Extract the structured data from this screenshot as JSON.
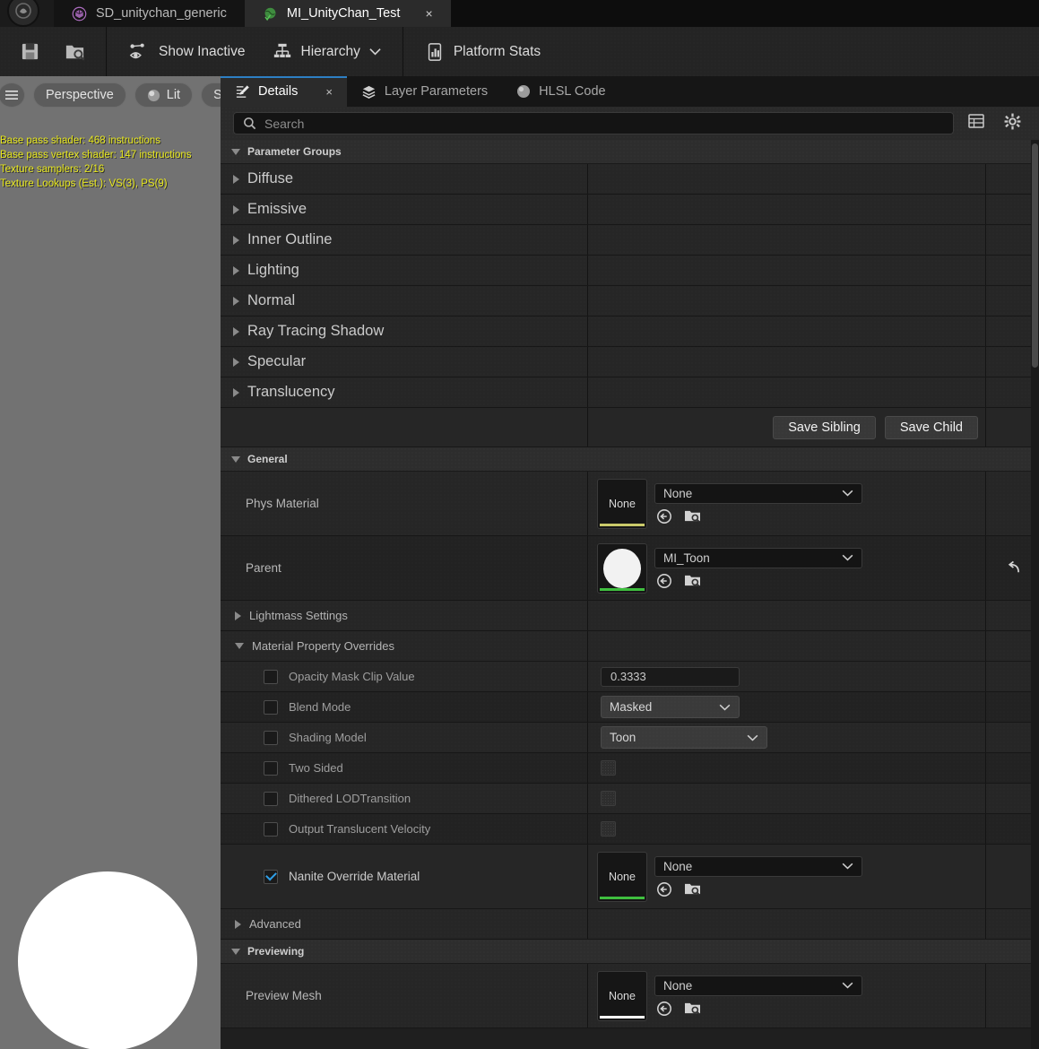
{
  "window": {
    "tabs": [
      {
        "label": "SD_unitychan_generic",
        "icon": "cube-purple-icon",
        "active": false,
        "closable": false
      },
      {
        "label": "MI_UnityChan_Test",
        "icon": "material-instance-green-icon",
        "active": true,
        "closable": true,
        "close_label": "×"
      }
    ]
  },
  "toolbar": {
    "icon_buttons": [
      {
        "name": "save-icon",
        "label": ""
      },
      {
        "name": "browse-icon",
        "label": ""
      }
    ],
    "buttons": [
      {
        "label": "Show Inactive",
        "icon": "show-inactive-eye-icon",
        "dropdown": false
      },
      {
        "label": "Hierarchy",
        "icon": "hierarchy-icon",
        "dropdown": true
      },
      {
        "label": "Platform Stats",
        "icon": "platform-stats-icon",
        "dropdown": false
      }
    ]
  },
  "viewport": {
    "pills": [
      {
        "label": "",
        "icon": "menu-hamburger-icon",
        "round": true
      },
      {
        "label": "Perspective",
        "icon": ""
      },
      {
        "label": "Lit",
        "icon": "lit-sphere-icon"
      },
      {
        "label": "S",
        "icon": ""
      }
    ],
    "stats_color": "#e8e81e",
    "stats": [
      "Base pass shader: 468 instructions",
      "Base pass vertex shader: 147 instructions",
      "Texture samplers: 2/16",
      "Texture Lookups (Est.): VS(3), PS(9)"
    ]
  },
  "details": {
    "tabs": [
      {
        "label": "Details",
        "icon": "details-pencil-icon",
        "active": true,
        "close_label": "×"
      },
      {
        "label": "Layer Parameters",
        "icon": "layers-icon",
        "active": false
      },
      {
        "label": "HLSL Code",
        "icon": "sphere-icon",
        "active": false
      }
    ],
    "search": {
      "placeholder": "Search",
      "value": "",
      "icon": "search-icon"
    },
    "search_actions": [
      {
        "name": "table-view-icon"
      },
      {
        "name": "settings-gear-icon"
      }
    ],
    "parameter_groups": {
      "title": "Parameter Groups",
      "expanded": true,
      "items": [
        {
          "label": "Diffuse",
          "expanded": false
        },
        {
          "label": "Emissive",
          "expanded": false
        },
        {
          "label": "Inner Outline",
          "expanded": false
        },
        {
          "label": "Lighting",
          "expanded": false
        },
        {
          "label": "Normal",
          "expanded": false
        },
        {
          "label": "Ray Tracing Shadow",
          "expanded": false
        },
        {
          "label": "Specular",
          "expanded": false
        },
        {
          "label": "Translucency",
          "expanded": false
        }
      ],
      "save_sibling_label": "Save Sibling",
      "save_child_label": "Save Child"
    },
    "general": {
      "title": "General",
      "expanded": true,
      "phys_material": {
        "label": "Phys Material",
        "thumb_label": "None",
        "thumb_bar_color": "#c9c96a",
        "value": "None",
        "actions": [
          "use-selected-asset-icon",
          "browse-content-icon"
        ]
      },
      "parent": {
        "label": "Parent",
        "thumb_label": "",
        "thumb_bar_color": "#3fbf3f",
        "value": "MI_Toon",
        "actions": [
          "use-selected-asset-icon",
          "browse-content-icon"
        ],
        "reset_icon": "reset-arrow-icon"
      },
      "lightmass_settings": {
        "label": "Lightmass Settings",
        "expanded": false
      },
      "material_property_overrides": {
        "label": "Material Property Overrides",
        "expanded": true,
        "rows": [
          {
            "label": "Opacity Mask Clip Value",
            "checked": false,
            "control": "number",
            "value": "0.3333"
          },
          {
            "label": "Blend Mode",
            "checked": false,
            "control": "select",
            "value": "Masked"
          },
          {
            "label": "Shading Model",
            "checked": false,
            "control": "select",
            "value": "Toon"
          },
          {
            "label": "Two Sided",
            "checked": false,
            "control": "bool",
            "value": ""
          },
          {
            "label": "Dithered LODTransition",
            "checked": false,
            "control": "bool",
            "value": ""
          },
          {
            "label": "Output Translucent Velocity",
            "checked": false,
            "control": "bool",
            "value": ""
          }
        ],
        "nanite_override": {
          "label": "Nanite Override Material",
          "checked": true,
          "thumb_label": "None",
          "thumb_bar_color": "#3fbf3f",
          "value": "None",
          "actions": [
            "use-selected-asset-icon",
            "browse-content-icon"
          ]
        }
      },
      "advanced": {
        "label": "Advanced",
        "expanded": false
      }
    },
    "previewing": {
      "title": "Previewing",
      "expanded": true,
      "preview_mesh": {
        "label": "Preview Mesh",
        "thumb_label": "None",
        "thumb_bar_color": "#ffffff",
        "value": "None",
        "actions": [
          "use-selected-asset-icon",
          "browse-content-icon"
        ]
      }
    }
  }
}
